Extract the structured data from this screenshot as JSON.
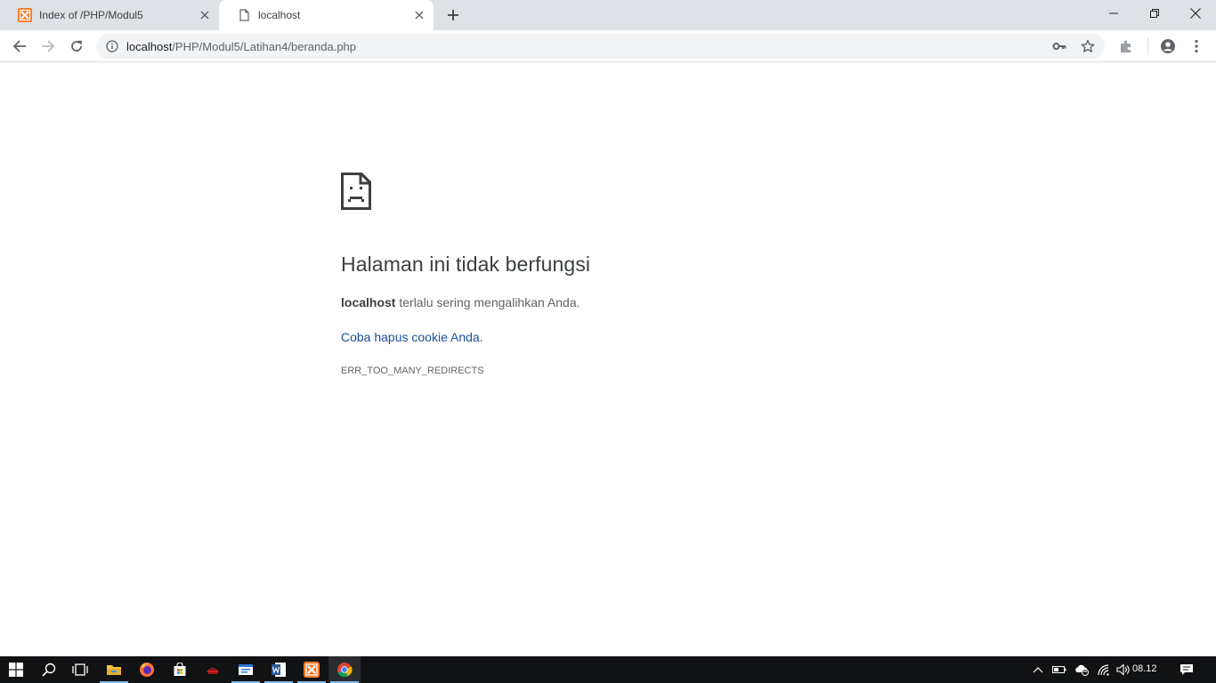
{
  "tabs": [
    {
      "title": "Index of /PHP/Modul5",
      "favicon": "xampp-icon",
      "active": false
    },
    {
      "title": "localhost",
      "favicon": "page-icon",
      "active": true
    }
  ],
  "omnibox": {
    "host": "localhost",
    "path": "/PHP/Modul5/Latihan4/beranda.php"
  },
  "error": {
    "title": "Halaman ini tidak berfungsi",
    "host": "localhost",
    "description": " terlalu sering mengalihkan Anda.",
    "suggestion": "Coba hapus cookie Anda.",
    "code": "ERR_TOO_MANY_REDIRECTS"
  },
  "taskbar": {
    "clock": "08.12"
  },
  "colors": {
    "tabstrip": "#dee1e6",
    "link": "#1a4f9c",
    "taskbar": "#111214",
    "taskbar_indicator": "#76b9ed"
  }
}
